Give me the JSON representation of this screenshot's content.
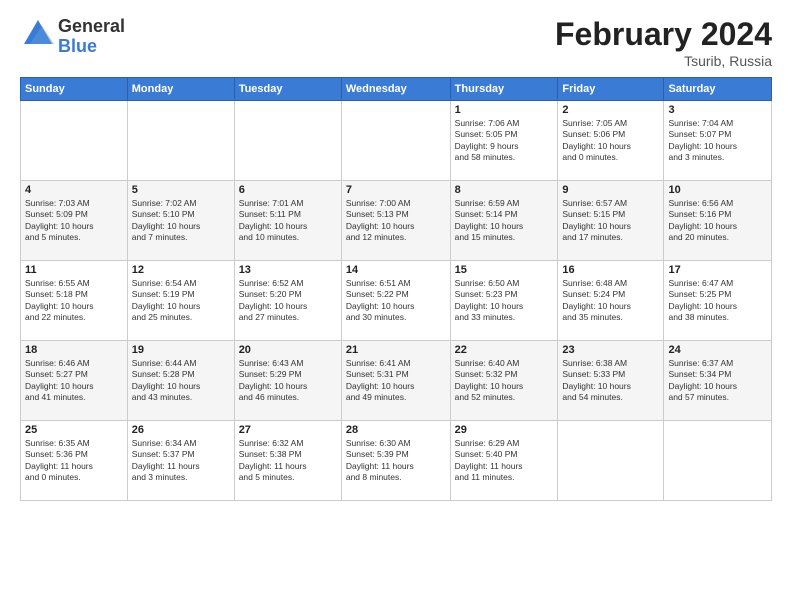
{
  "logo": {
    "general": "General",
    "blue": "Blue"
  },
  "header": {
    "title": "February 2024",
    "location": "Tsurib, Russia"
  },
  "weekdays": [
    "Sunday",
    "Monday",
    "Tuesday",
    "Wednesday",
    "Thursday",
    "Friday",
    "Saturday"
  ],
  "weeks": [
    [
      {
        "day": "",
        "detail": ""
      },
      {
        "day": "",
        "detail": ""
      },
      {
        "day": "",
        "detail": ""
      },
      {
        "day": "",
        "detail": ""
      },
      {
        "day": "1",
        "detail": "Sunrise: 7:06 AM\nSunset: 5:05 PM\nDaylight: 9 hours\nand 58 minutes."
      },
      {
        "day": "2",
        "detail": "Sunrise: 7:05 AM\nSunset: 5:06 PM\nDaylight: 10 hours\nand 0 minutes."
      },
      {
        "day": "3",
        "detail": "Sunrise: 7:04 AM\nSunset: 5:07 PM\nDaylight: 10 hours\nand 3 minutes."
      }
    ],
    [
      {
        "day": "4",
        "detail": "Sunrise: 7:03 AM\nSunset: 5:09 PM\nDaylight: 10 hours\nand 5 minutes."
      },
      {
        "day": "5",
        "detail": "Sunrise: 7:02 AM\nSunset: 5:10 PM\nDaylight: 10 hours\nand 7 minutes."
      },
      {
        "day": "6",
        "detail": "Sunrise: 7:01 AM\nSunset: 5:11 PM\nDaylight: 10 hours\nand 10 minutes."
      },
      {
        "day": "7",
        "detail": "Sunrise: 7:00 AM\nSunset: 5:13 PM\nDaylight: 10 hours\nand 12 minutes."
      },
      {
        "day": "8",
        "detail": "Sunrise: 6:59 AM\nSunset: 5:14 PM\nDaylight: 10 hours\nand 15 minutes."
      },
      {
        "day": "9",
        "detail": "Sunrise: 6:57 AM\nSunset: 5:15 PM\nDaylight: 10 hours\nand 17 minutes."
      },
      {
        "day": "10",
        "detail": "Sunrise: 6:56 AM\nSunset: 5:16 PM\nDaylight: 10 hours\nand 20 minutes."
      }
    ],
    [
      {
        "day": "11",
        "detail": "Sunrise: 6:55 AM\nSunset: 5:18 PM\nDaylight: 10 hours\nand 22 minutes."
      },
      {
        "day": "12",
        "detail": "Sunrise: 6:54 AM\nSunset: 5:19 PM\nDaylight: 10 hours\nand 25 minutes."
      },
      {
        "day": "13",
        "detail": "Sunrise: 6:52 AM\nSunset: 5:20 PM\nDaylight: 10 hours\nand 27 minutes."
      },
      {
        "day": "14",
        "detail": "Sunrise: 6:51 AM\nSunset: 5:22 PM\nDaylight: 10 hours\nand 30 minutes."
      },
      {
        "day": "15",
        "detail": "Sunrise: 6:50 AM\nSunset: 5:23 PM\nDaylight: 10 hours\nand 33 minutes."
      },
      {
        "day": "16",
        "detail": "Sunrise: 6:48 AM\nSunset: 5:24 PM\nDaylight: 10 hours\nand 35 minutes."
      },
      {
        "day": "17",
        "detail": "Sunrise: 6:47 AM\nSunset: 5:25 PM\nDaylight: 10 hours\nand 38 minutes."
      }
    ],
    [
      {
        "day": "18",
        "detail": "Sunrise: 6:46 AM\nSunset: 5:27 PM\nDaylight: 10 hours\nand 41 minutes."
      },
      {
        "day": "19",
        "detail": "Sunrise: 6:44 AM\nSunset: 5:28 PM\nDaylight: 10 hours\nand 43 minutes."
      },
      {
        "day": "20",
        "detail": "Sunrise: 6:43 AM\nSunset: 5:29 PM\nDaylight: 10 hours\nand 46 minutes."
      },
      {
        "day": "21",
        "detail": "Sunrise: 6:41 AM\nSunset: 5:31 PM\nDaylight: 10 hours\nand 49 minutes."
      },
      {
        "day": "22",
        "detail": "Sunrise: 6:40 AM\nSunset: 5:32 PM\nDaylight: 10 hours\nand 52 minutes."
      },
      {
        "day": "23",
        "detail": "Sunrise: 6:38 AM\nSunset: 5:33 PM\nDaylight: 10 hours\nand 54 minutes."
      },
      {
        "day": "24",
        "detail": "Sunrise: 6:37 AM\nSunset: 5:34 PM\nDaylight: 10 hours\nand 57 minutes."
      }
    ],
    [
      {
        "day": "25",
        "detail": "Sunrise: 6:35 AM\nSunset: 5:36 PM\nDaylight: 11 hours\nand 0 minutes."
      },
      {
        "day": "26",
        "detail": "Sunrise: 6:34 AM\nSunset: 5:37 PM\nDaylight: 11 hours\nand 3 minutes."
      },
      {
        "day": "27",
        "detail": "Sunrise: 6:32 AM\nSunset: 5:38 PM\nDaylight: 11 hours\nand 5 minutes."
      },
      {
        "day": "28",
        "detail": "Sunrise: 6:30 AM\nSunset: 5:39 PM\nDaylight: 11 hours\nand 8 minutes."
      },
      {
        "day": "29",
        "detail": "Sunrise: 6:29 AM\nSunset: 5:40 PM\nDaylight: 11 hours\nand 11 minutes."
      },
      {
        "day": "",
        "detail": ""
      },
      {
        "day": "",
        "detail": ""
      }
    ]
  ]
}
